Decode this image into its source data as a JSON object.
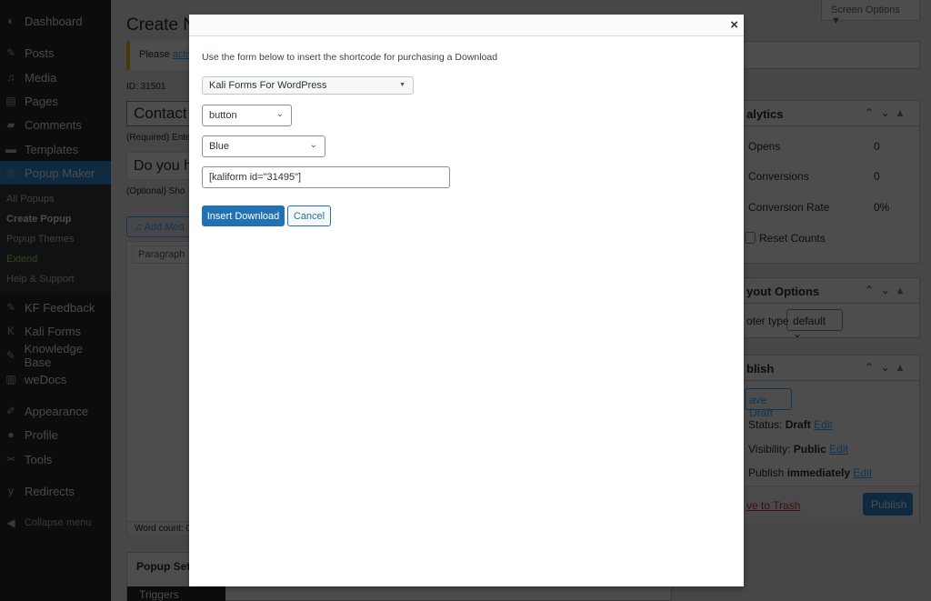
{
  "sidebar": {
    "items": [
      {
        "label": "Dashboard",
        "icon": "dashboard-icon",
        "glyph": "◐"
      },
      {
        "label": "Posts",
        "icon": "pin-icon",
        "glyph": "✎"
      },
      {
        "label": "Media",
        "icon": "media-icon",
        "glyph": "♫"
      },
      {
        "label": "Pages",
        "icon": "pages-icon",
        "glyph": "▤"
      },
      {
        "label": "Comments",
        "icon": "comment-icon",
        "glyph": "▰"
      },
      {
        "label": "Templates",
        "icon": "folder-icon",
        "glyph": "▬"
      },
      {
        "label": "Popup Maker",
        "icon": "popup-maker-icon",
        "glyph": "◎"
      },
      {
        "label": "KF Feedback",
        "icon": "pin-icon",
        "glyph": "✎"
      },
      {
        "label": "Kali Forms",
        "icon": "kali-forms-icon",
        "glyph": "K"
      },
      {
        "label": "Knowledge Base",
        "icon": "pin-icon",
        "glyph": "✎"
      },
      {
        "label": "weDocs",
        "icon": "document-icon",
        "glyph": "▥"
      },
      {
        "label": "Appearance",
        "icon": "brush-icon",
        "glyph": "✐"
      },
      {
        "label": "Profile",
        "icon": "user-icon",
        "glyph": "●"
      },
      {
        "label": "Tools",
        "icon": "wrench-icon",
        "glyph": "✂"
      },
      {
        "label": "Redirects",
        "icon": "yoast-icon",
        "glyph": "y"
      },
      {
        "label": "Collapse menu",
        "icon": "collapse-icon",
        "glyph": "◀"
      }
    ],
    "submenu": [
      "All Popups",
      "Create Popup",
      "Popup Themes",
      "Extend",
      "Help & Support"
    ]
  },
  "main": {
    "title": "Create N",
    "notice": "Please ",
    "notice_link": "activ",
    "id_label": "ID: 31501",
    "title_value": "Contact",
    "title_help": "(Required) Ente",
    "subtitle_value": "Do you h",
    "subtitle_help": "(Optional) Sho",
    "add_media": "Add Med",
    "paragraph": "Paragraph",
    "word_count": "Word count: 0",
    "popup_settings": "Popup Sett",
    "triggers": "Triggers"
  },
  "right": {
    "screen_options": "Screen Options ▼",
    "analytics": {
      "title": "alytics",
      "rows": [
        {
          "label": "Opens",
          "value": "0"
        },
        {
          "label": "Conversions",
          "value": "0"
        },
        {
          "label": "Conversion Rate",
          "value": "0%"
        }
      ],
      "reset": "Reset Counts"
    },
    "layout": {
      "title": "yout Options",
      "label": "oter type",
      "select": "default"
    },
    "publish": {
      "title": "blish",
      "save_draft": "ave Draft",
      "status_label": "Status: ",
      "status": "Draft",
      "visibility_label": "Visibility: ",
      "visibility": "Public",
      "publish_label": "Publish ",
      "publish_when": "immediately",
      "edit": "Edit",
      "trash": "ve to Trash",
      "publish_button": "Publish"
    }
  },
  "modal": {
    "intro": "Use the form below to insert the shortcode for purchasing a Download",
    "form_select": "Kali Forms For WordPress",
    "style_select": "button",
    "color_select": "Blue",
    "shortcode": "[kaliform id=\"31495\"]",
    "insert": "Insert Download",
    "cancel": "Cancel",
    "close": "×"
  },
  "colors": {
    "accent": "#2271b1",
    "sidebar": "#1d2327"
  }
}
